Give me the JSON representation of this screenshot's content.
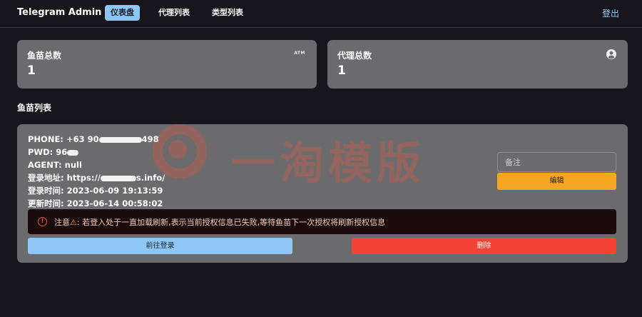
{
  "navbar": {
    "brand": "Telegram Admin",
    "items": [
      {
        "label": "仪表盘",
        "active": true
      },
      {
        "label": "代理列表",
        "active": false
      },
      {
        "label": "类型列表",
        "active": false
      }
    ],
    "logout": "登出"
  },
  "stats": {
    "fish_total": {
      "label": "鱼苗总数",
      "value": "1",
      "icon": "atm-icon",
      "icon_text": "ATM"
    },
    "agent_total": {
      "label": "代理总数",
      "value": "1",
      "icon": "user-circle-icon"
    }
  },
  "section_title": "鱼苗列表",
  "watermark": "一淘模版",
  "fish_item": {
    "phone_label": "PHONE:",
    "phone_prefix": "+63 90",
    "phone_suffix": "498",
    "pwd_label": "PWD:",
    "pwd_prefix": "96",
    "agent_label": "AGENT:",
    "agent_value": "null",
    "login_url_label": "登录地址:",
    "login_url_prefix": "https://",
    "login_url_suffix": "s.info/",
    "login_time_label": "登录时间:",
    "login_time_value": "2023-06-09 19:13:59",
    "update_time_label": "更新时间:",
    "update_time_value": "2023-06-14 00:58:02",
    "remark_placeholder": "备注",
    "edit_label": "编辑",
    "alert_prefix": "注意",
    "alert_text": ": 若登入处于一直加载刷新,表示当前授权信息已失败,等待鱼苗下一次授权将刷新授权信息",
    "goto_login_label": "前往登录",
    "delete_label": "删除"
  },
  "colors": {
    "background": "#17161c",
    "card": "#6b6b6e",
    "primary": "#8ec7f5",
    "warning": "#f5a623",
    "danger": "#f44336",
    "alert_bg": "#1a0c0c"
  }
}
